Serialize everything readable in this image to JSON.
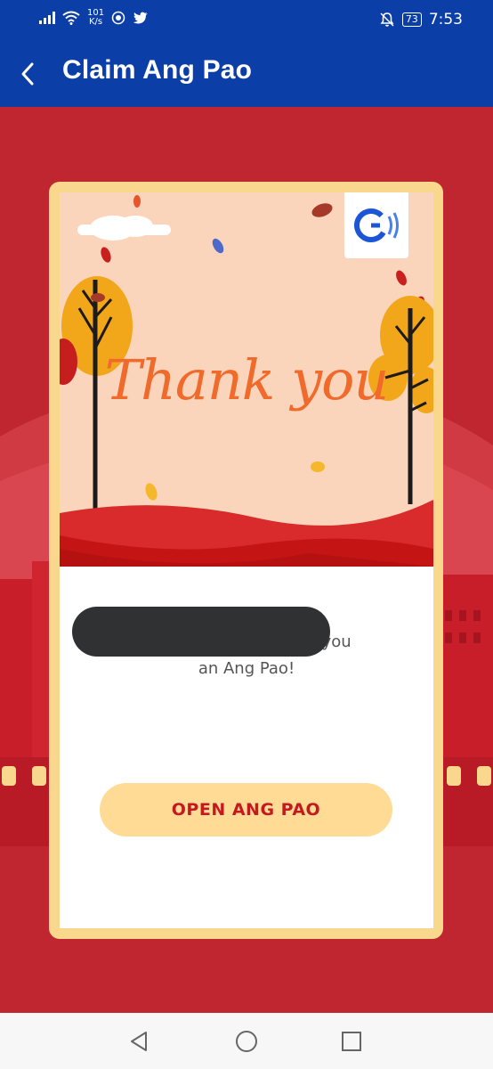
{
  "status_bar": {
    "network_speed_value": "101",
    "network_speed_unit": "K/s",
    "battery": "73",
    "time": "7:53"
  },
  "app_bar": {
    "title": "Claim Ang Pao"
  },
  "card": {
    "headline": "Thank you",
    "message_line1": "sent you",
    "message_line2": "an Ang Pao!",
    "open_button_label": "OPEN ANG PAO"
  },
  "colors": {
    "header_blue": "#0c3ea8",
    "background_red": "#c0262f",
    "card_border": "#f9d78c",
    "button_fill": "#ffdb96",
    "button_text": "#c41a1f",
    "headline_orange": "#f06a2c"
  },
  "icons": {
    "back": "arrow-back-icon",
    "logo": "gcash-logo-icon",
    "nav_back": "triangle-back-icon",
    "nav_home": "circle-home-icon",
    "nav_recents": "square-recents-icon"
  }
}
